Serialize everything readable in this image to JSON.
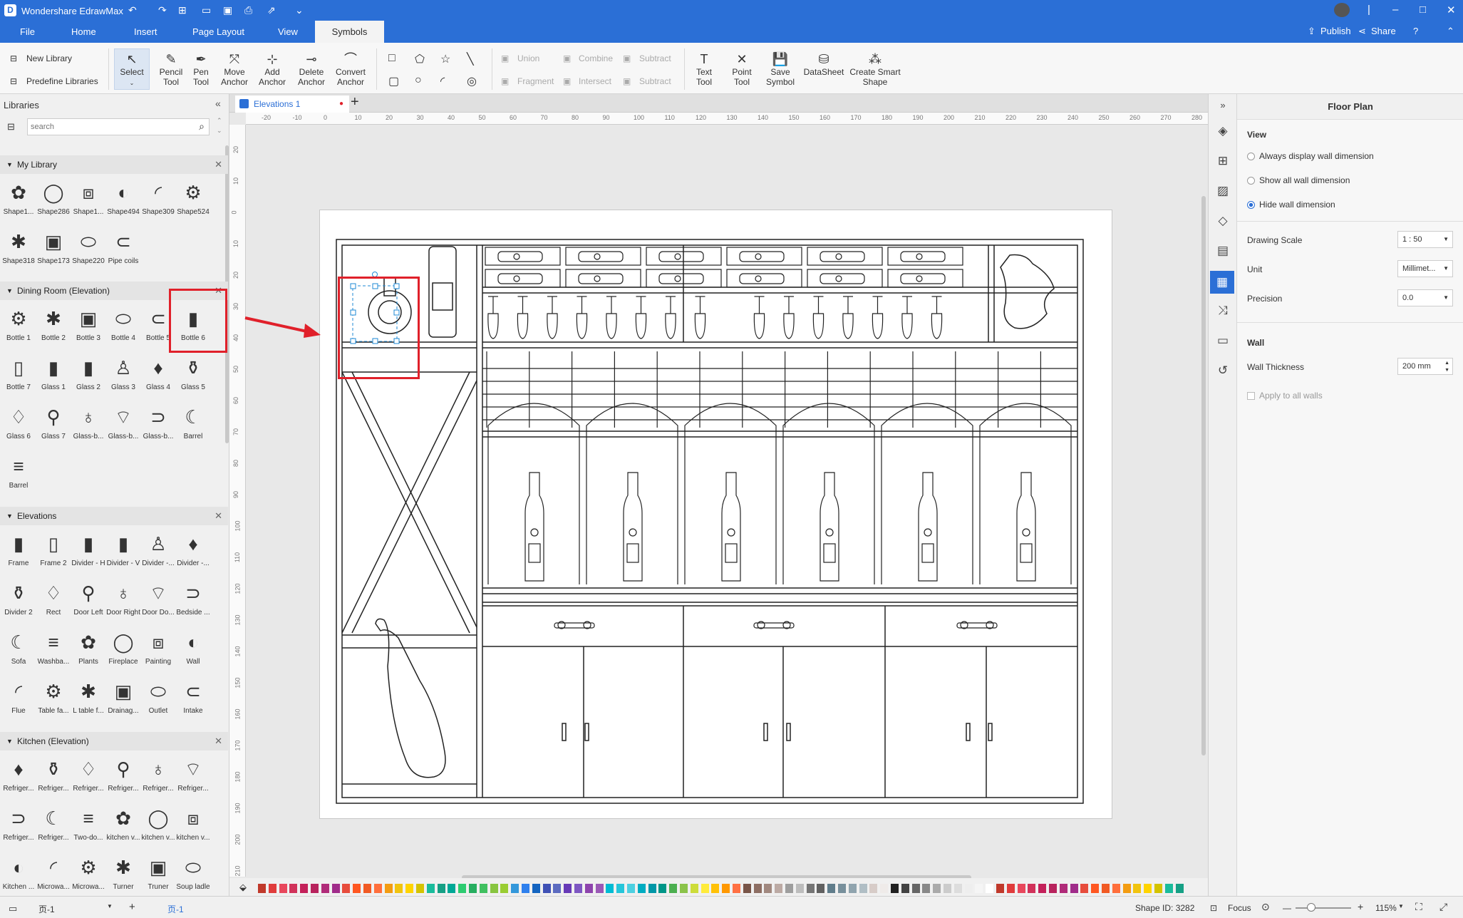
{
  "app": {
    "title": "Wondershare EdrawMax"
  },
  "menu": {
    "file": "File",
    "home": "Home",
    "insert": "Insert",
    "page_layout": "Page Layout",
    "view": "View",
    "symbols": "Symbols",
    "publish": "Publish",
    "share": "Share"
  },
  "ribbon": {
    "new_library": "New Library",
    "predefine_libraries": "Predefine Libraries",
    "select": "Select",
    "pencil_tool": [
      "Pencil",
      "Tool"
    ],
    "pen_tool": [
      "Pen",
      "Tool"
    ],
    "move_anchor": [
      "Move",
      "Anchor"
    ],
    "add_anchor": [
      "Add",
      "Anchor"
    ],
    "delete_anchor": [
      "Delete",
      "Anchor"
    ],
    "convert_anchor": [
      "Convert",
      "Anchor"
    ],
    "union": "Union",
    "combine": "Combine",
    "subtract": "Subtract",
    "fragment": "Fragment",
    "intersect": "Intersect",
    "subtract2": "Subtract",
    "text_tool": [
      "Text",
      "Tool"
    ],
    "point_tool": [
      "Point",
      "Tool"
    ],
    "save_symbol": [
      "Save",
      "Symbol"
    ],
    "datasheet": "DataSheet",
    "create_smart_shape": [
      "Create Smart",
      "Shape"
    ]
  },
  "libraries": {
    "title": "Libraries",
    "search_placeholder": "search",
    "groups": [
      {
        "name": "My Library",
        "items": [
          "Shape1...",
          "Shape286",
          "Shape1...",
          "Shape494",
          "Shape309",
          "Shape524",
          "Shape318",
          "Shape173",
          "Shape220",
          "Pipe coils"
        ]
      },
      {
        "name": "Dining Room (Elevation)",
        "items": [
          "Bottle 1",
          "Bottle 2",
          "Bottle 3",
          "Bottle 4",
          "Bottle 5",
          "Bottle 6",
          "Bottle 7",
          "Glass 1",
          "Glass 2",
          "Glass 3",
          "Glass 4",
          "Glass 5",
          "Glass 6",
          "Glass 7",
          "Glass-b...",
          "Glass-b...",
          "Glass-b...",
          "Barrel",
          "Barrel"
        ]
      },
      {
        "name": "Elevations",
        "items": [
          "Frame",
          "Frame 2",
          "Divider - H",
          "Divider - V",
          "Divider -...",
          "Divider -...",
          "Divider 2",
          "Rect",
          "Door Left",
          "Door Right",
          "Door Do...",
          "Bedside ...",
          "Sofa",
          "Washba...",
          "Plants",
          "Fireplace",
          "Painting",
          "Wall",
          "Flue",
          "Table fa...",
          "L table f...",
          "Drainag...",
          "Outlet",
          "Intake"
        ]
      },
      {
        "name": "Kitchen (Elevation)",
        "items": [
          "Refriger...",
          "Refriger...",
          "Refriger...",
          "Refriger...",
          "Refriger...",
          "Refriger...",
          "Refriger...",
          "Refriger...",
          "Two-do...",
          "kitchen v...",
          "kitchen v...",
          "kitchen v...",
          "Kitchen ...",
          "Microwa...",
          "Microwa...",
          "Turner",
          "Truner",
          "Soup ladle"
        ]
      }
    ]
  },
  "document": {
    "tab": "Elevations 1"
  },
  "ruler": {
    "h": [
      "-20",
      "-10",
      "0",
      "10",
      "20",
      "30",
      "40",
      "50",
      "60",
      "70",
      "80",
      "90",
      "100",
      "110",
      "120",
      "130",
      "140",
      "150",
      "160",
      "170",
      "180",
      "190",
      "200",
      "210",
      "220",
      "230",
      "240",
      "250",
      "260",
      "270",
      "280"
    ],
    "v": [
      "20",
      "10",
      "0",
      "10",
      "20",
      "30",
      "40",
      "50",
      "60",
      "70",
      "80",
      "90",
      "100",
      "110",
      "120",
      "130",
      "140",
      "150",
      "160",
      "170",
      "180",
      "190",
      "200",
      "210"
    ]
  },
  "floor_plan": {
    "title": "Floor Plan",
    "view_label": "View",
    "radio": [
      "Always display wall dimension",
      "Show all wall dimension",
      "Hide wall dimension"
    ],
    "selected_radio": 2,
    "drawing_scale_label": "Drawing Scale",
    "drawing_scale": "1 : 50",
    "unit_label": "Unit",
    "unit": "Millimet...",
    "precision_label": "Precision",
    "precision": "0.0",
    "wall_label": "Wall",
    "wall_thickness_label": "Wall Thickness",
    "wall_thickness": "200 mm",
    "apply_all": "Apply to all walls"
  },
  "status": {
    "page_select": "页-1",
    "page_tab": "页-1",
    "shape_id": "Shape ID: 3282",
    "focus": "Focus",
    "zoom": "115%"
  },
  "colors": {
    "accent": "#2b6fd6",
    "highlight": "#e0202a"
  }
}
